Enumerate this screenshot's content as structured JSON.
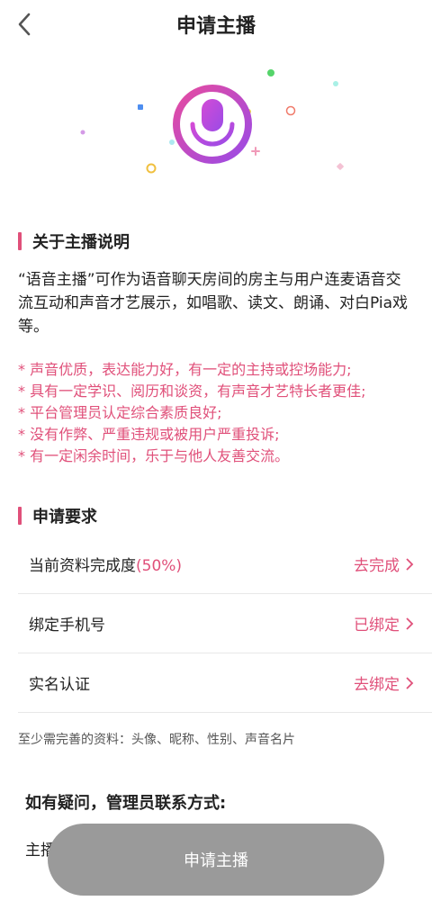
{
  "header": {
    "title": "申请主播",
    "back_icon": "chevron-left-icon"
  },
  "hero": {
    "icon": "microphone-icon",
    "colors": {
      "gradient_start": "#e64ba0",
      "gradient_end": "#9a4be6"
    }
  },
  "about": {
    "heading": "关于主播说明",
    "paragraph": "“语音主播”可作为语音聊天房间的房主与用户连麦语音交流互动和声音才艺展示，如唱歌、读文、朗诵、对白Pia戏等。",
    "requirements": [
      "* 声音优质，表达能力好，有一定的主持或控场能力;",
      "* 具有一定学识、阅历和谈资，有声音才艺特长者更佳;",
      "* 平台管理员认定综合素质良好;",
      "* 没有作弊、严重违规或被用户严重投诉;",
      "* 有一定闲余时间，乐于与他人友善交流。"
    ]
  },
  "apply_requirements": {
    "heading": "申请要求",
    "rows": [
      {
        "label": "当前资料完成度",
        "suffix": "(50%)",
        "action": "去完成"
      },
      {
        "label": "绑定手机号",
        "suffix": "",
        "action": "已绑定"
      },
      {
        "label": "实名认证",
        "suffix": "",
        "action": "去绑定"
      }
    ],
    "hint": "至少需完善的资料：头像、昵称、性别、声音名片"
  },
  "contact": {
    "heading": "如有疑问，管理员联系方式:",
    "line_prefix": "主播"
  },
  "apply_button": {
    "label": "申请主播"
  },
  "theme": {
    "accent": "#e0507a",
    "button_disabled": "#9a9a9a"
  }
}
